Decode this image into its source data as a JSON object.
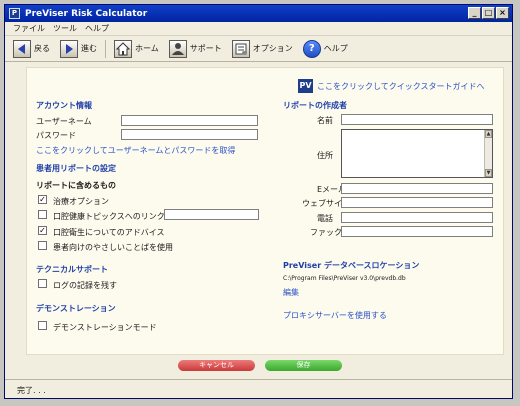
{
  "window": {
    "title": "PreViser Risk Calculator",
    "app_icon_text": "P",
    "minimize": "_",
    "maximize": "□",
    "close": "×"
  },
  "menu": [
    "ファイル",
    "ツール",
    "ヘルプ"
  ],
  "toolbar": {
    "back": "戻る",
    "forward": "進む",
    "home": "ホーム",
    "support": "サポート",
    "options": "オプション",
    "help": "ヘルプ"
  },
  "quickstart": {
    "logo": "PV",
    "link": "ここをクリックしてクイックスタートガイドへ"
  },
  "account": {
    "heading": "アカウント情報",
    "username_label": "ユーザーネーム",
    "username_value": "",
    "password_label": "パスワード",
    "password_value": "",
    "get_link": "ここをクリックしてユーザーネームとパスワードを取得"
  },
  "patient_report": {
    "heading": "患者用リポートの設定",
    "includes_label": "リポートに含めるもの",
    "options": [
      {
        "label": "治療オプション",
        "checked": true
      },
      {
        "label": "口腔健康トピックスへのリンク",
        "checked": false
      },
      {
        "label": "口腔衛生についてのアドバイス",
        "checked": true
      },
      {
        "label": "患者向けのやさしいことばを使用",
        "checked": false
      }
    ],
    "link_field_value": ""
  },
  "tech_support": {
    "heading": "テクニカルサポート",
    "log_label": "ログの記録を残す",
    "log_checked": false
  },
  "demo": {
    "heading": "デモンストレーション",
    "mode_label": "デモンストレーションモード",
    "mode_checked": false
  },
  "author": {
    "heading": "リポートの作成者",
    "name_label": "名前",
    "address_label": "住所",
    "email_label": "Eメール",
    "website_label": "ウェブサイト",
    "phone_label": "電話",
    "fax_label": "ファックス"
  },
  "db": {
    "heading": "PreViser データベースロケーション",
    "path": "C:\\Program Files\\PreViser v3.0\\prevdb.db",
    "edit_link": "編集",
    "proxy_link": "プロキシサーバーを使用する"
  },
  "buttons": {
    "cancel": "キャンセル",
    "save": "保存"
  },
  "status": "完了. . ."
}
